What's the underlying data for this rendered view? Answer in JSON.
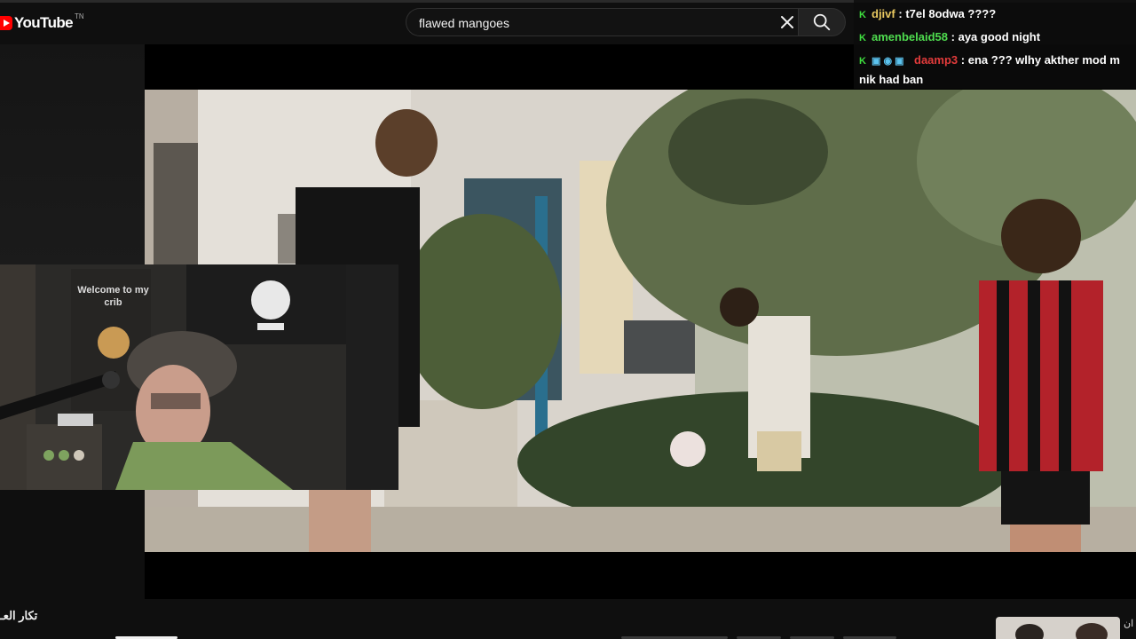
{
  "app": {
    "logo_text": "YouTube",
    "logo_superscript": "TN"
  },
  "search": {
    "query": "flawed mangoes",
    "clear_icon": "close-icon",
    "search_icon": "search-icon"
  },
  "chat": {
    "messages": [
      {
        "user": "djivf",
        "text": "t7el 8odwa ????",
        "user_color": "#e8c860"
      },
      {
        "user": "amenbelaid58",
        "text": "aya good night",
        "user_color": "#4fdc4f"
      },
      {
        "user": "daamp3",
        "text": "ena ??? wlhy akther mod m",
        "text_continued": "nik had ban",
        "user_color": "#e23b3b"
      }
    ],
    "separator": ":"
  },
  "webcam": {
    "banner_text": "Welcome to my crib"
  },
  "below_player": {
    "title": "تكار العـ",
    "right_label": "ان"
  },
  "colors": {
    "brand": "#ff0000",
    "background": "#0f0f0f",
    "mod_badge": "#3fdf3f"
  }
}
